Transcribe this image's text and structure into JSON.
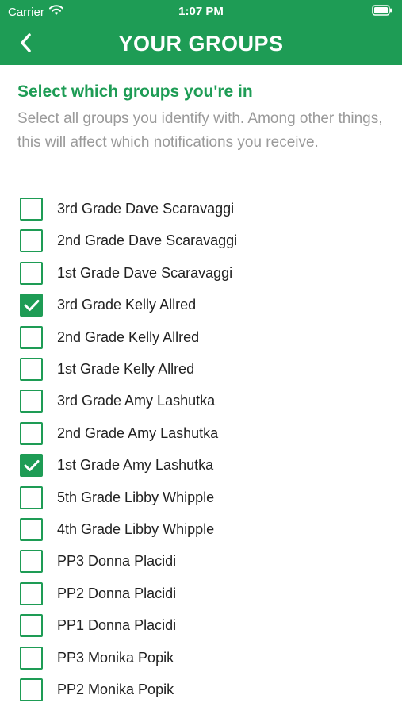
{
  "status_bar": {
    "carrier": "Carrier",
    "time": "1:07 PM"
  },
  "nav": {
    "title": "YOUR GROUPS",
    "back_icon": "chevron-left-icon"
  },
  "header": {
    "heading": "Select which groups you're in",
    "description": "Select all groups you identify with. Among other things, this will affect which notifications you receive."
  },
  "colors": {
    "accent": "#1e9c55",
    "secondary_text": "#9a9a9a",
    "primary_text": "#222222"
  },
  "groups": [
    {
      "label": "3rd Grade Dave Scaravaggi",
      "checked": false
    },
    {
      "label": "2nd Grade Dave Scaravaggi",
      "checked": false
    },
    {
      "label": "1st Grade Dave Scaravaggi",
      "checked": false
    },
    {
      "label": "3rd Grade Kelly Allred",
      "checked": true
    },
    {
      "label": "2nd Grade Kelly Allred",
      "checked": false
    },
    {
      "label": "1st Grade Kelly Allred",
      "checked": false
    },
    {
      "label": "3rd Grade Amy Lashutka",
      "checked": false
    },
    {
      "label": "2nd Grade Amy Lashutka",
      "checked": false
    },
    {
      "label": "1st Grade Amy Lashutka",
      "checked": true
    },
    {
      "label": "5th Grade Libby Whipple",
      "checked": false
    },
    {
      "label": "4th Grade Libby Whipple",
      "checked": false
    },
    {
      "label": "PP3 Donna Placidi",
      "checked": false
    },
    {
      "label": "PP2 Donna Placidi",
      "checked": false
    },
    {
      "label": "PP1 Donna Placidi",
      "checked": false
    },
    {
      "label": "PP3 Monika Popik",
      "checked": false
    },
    {
      "label": "PP2 Monika Popik",
      "checked": false
    }
  ]
}
